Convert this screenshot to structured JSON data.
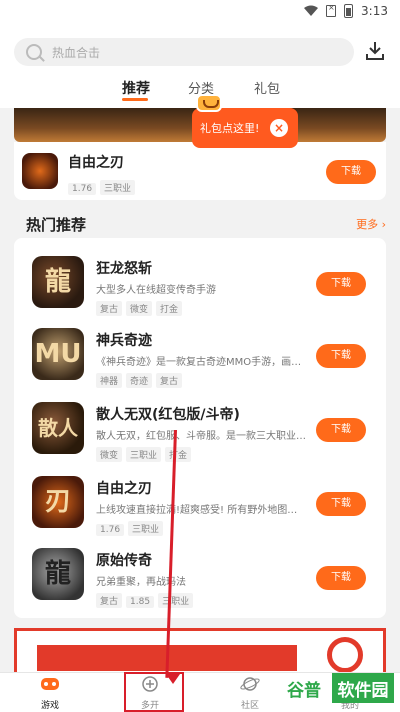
{
  "status": {
    "time": "3:13"
  },
  "search": {
    "placeholder": "热血合击"
  },
  "tabs": [
    {
      "label": "推荐"
    },
    {
      "label": "分类"
    },
    {
      "label": "礼包"
    }
  ],
  "tooltip": {
    "text": "礼包点这里!",
    "close": "×"
  },
  "top_app": {
    "name": "自由之刃",
    "tags": [
      "1.76",
      "三职业"
    ],
    "button": "下载"
  },
  "section": {
    "title": "热门推荐",
    "more": "更多 ›"
  },
  "apps": [
    {
      "name": "狂龙怒斩",
      "desc": "大型多人在线超变传奇手游",
      "tags": [
        "复古",
        "微变",
        "打金"
      ],
      "button": "下载",
      "glyph": "龍"
    },
    {
      "name": "神兵奇迹",
      "desc": "《神兵奇迹》是一款复古奇迹MMO手游，画面…",
      "tags": [
        "神器",
        "奇迹",
        "复古"
      ],
      "button": "下载",
      "glyph": "MU"
    },
    {
      "name": "散人无双(红包版/斗帝)",
      "desc": "散人无双，红包服、斗帝服。是一款三大职业…",
      "tags": [
        "微变",
        "三职业",
        "打金"
      ],
      "button": "下载",
      "glyph": "散人"
    },
    {
      "name": "自由之刃",
      "desc": "上线攻速直接拉满!超爽感受! 所有野外地图…",
      "tags": [
        "1.76",
        "三职业"
      ],
      "button": "下载",
      "glyph": "刃"
    },
    {
      "name": "原始传奇",
      "desc": "兄弟重聚，再战玛法",
      "tags": [
        "复古",
        "1.85",
        "三职业"
      ],
      "button": "下载",
      "glyph": "龍"
    }
  ],
  "nav": [
    {
      "label": "游戏"
    },
    {
      "label": "多开"
    },
    {
      "label": "社区"
    },
    {
      "label": "我的"
    }
  ],
  "watermark": {
    "part1": "谷普",
    "part2": "软件园"
  }
}
